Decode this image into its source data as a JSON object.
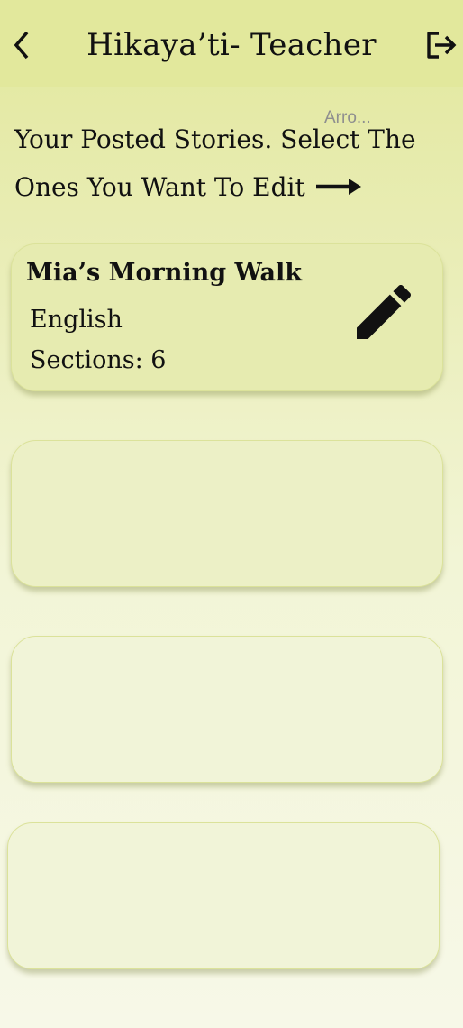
{
  "header": {
    "title": "Hikaya’ti- Teacher",
    "back_icon": "chevron-left-icon",
    "logout_icon": "logout-icon"
  },
  "tooltip": {
    "text": "Arro..."
  },
  "instructions": {
    "line1": "Your Posted Stories. Select The",
    "line2": "Ones You Want To Edit",
    "arrow_icon": "arrow-right-icon"
  },
  "stories": [
    {
      "title": "Mia’s Morning Walk",
      "language": "English",
      "sections": "Sections: 6",
      "edit_icon": "pencil-icon"
    }
  ],
  "colors": {
    "header_bg": "#e2e89c",
    "card_border": "#dbe29a",
    "text": "#111111",
    "tooltip_text": "#8f8f8f"
  }
}
